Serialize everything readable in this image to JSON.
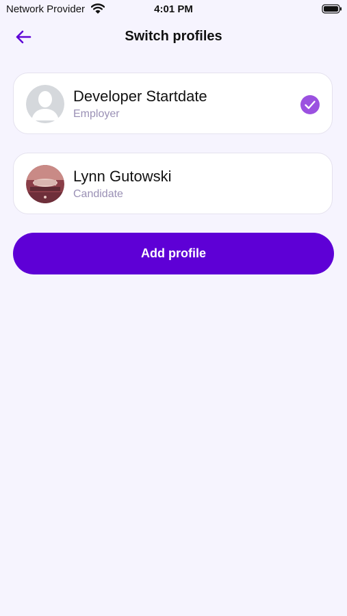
{
  "status_bar": {
    "carrier": "Network Provider",
    "time": "4:01 PM",
    "icons": [
      "wifi-icon",
      "battery-icon"
    ]
  },
  "header": {
    "title": "Switch profiles",
    "back_icon": "arrow-left-icon"
  },
  "profiles": [
    {
      "name": "Developer Startdate",
      "role": "Employer",
      "avatar": "default-person-silhouette",
      "selected": true
    },
    {
      "name": "Lynn Gutowski",
      "role": "Candidate",
      "avatar": "photo",
      "selected": false
    }
  ],
  "actions": {
    "add_profile_label": "Add profile"
  },
  "colors": {
    "background": "#F6F4FE",
    "accent": "#5E00D6",
    "check": "#9B51E0",
    "secondary_text": "#9A90B5",
    "card_border": "#E4E1EE"
  }
}
